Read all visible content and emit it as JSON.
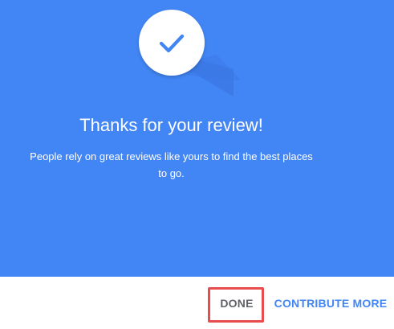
{
  "dialog": {
    "accent_color": "#4285f4",
    "icon": "checkmark-icon",
    "title": "Thanks for your review!",
    "message": "People rely on great reviews like yours to find the best places to go."
  },
  "actions": {
    "done_label": "DONE",
    "contribute_label": "CONTRIBUTE MORE"
  },
  "annotation": {
    "highlight_color": "#e84c4c"
  }
}
